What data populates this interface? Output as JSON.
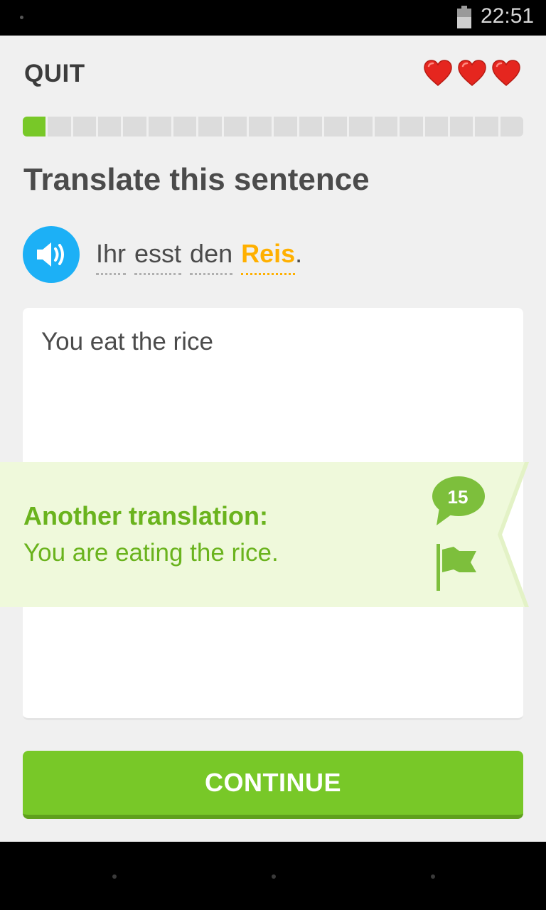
{
  "status_bar": {
    "time": "22:51"
  },
  "header": {
    "quit_label": "QUIT",
    "hearts_remaining": 3
  },
  "progress": {
    "segments": 20,
    "completed": 1
  },
  "exercise": {
    "instruction": "Translate this sentence",
    "words": [
      "Ihr",
      "esst",
      "den"
    ],
    "highlight_word": "Reis",
    "punctuation": ".",
    "answer": "You eat the rice"
  },
  "feedback": {
    "title": "Another translation:",
    "text": "You are eating the rice.",
    "comment_count": "15"
  },
  "actions": {
    "continue_label": "CONTINUE"
  },
  "colors": {
    "green": "#78c828",
    "blue": "#1cb0f6",
    "highlight": "#ffb000",
    "heart": "#e5261f"
  }
}
